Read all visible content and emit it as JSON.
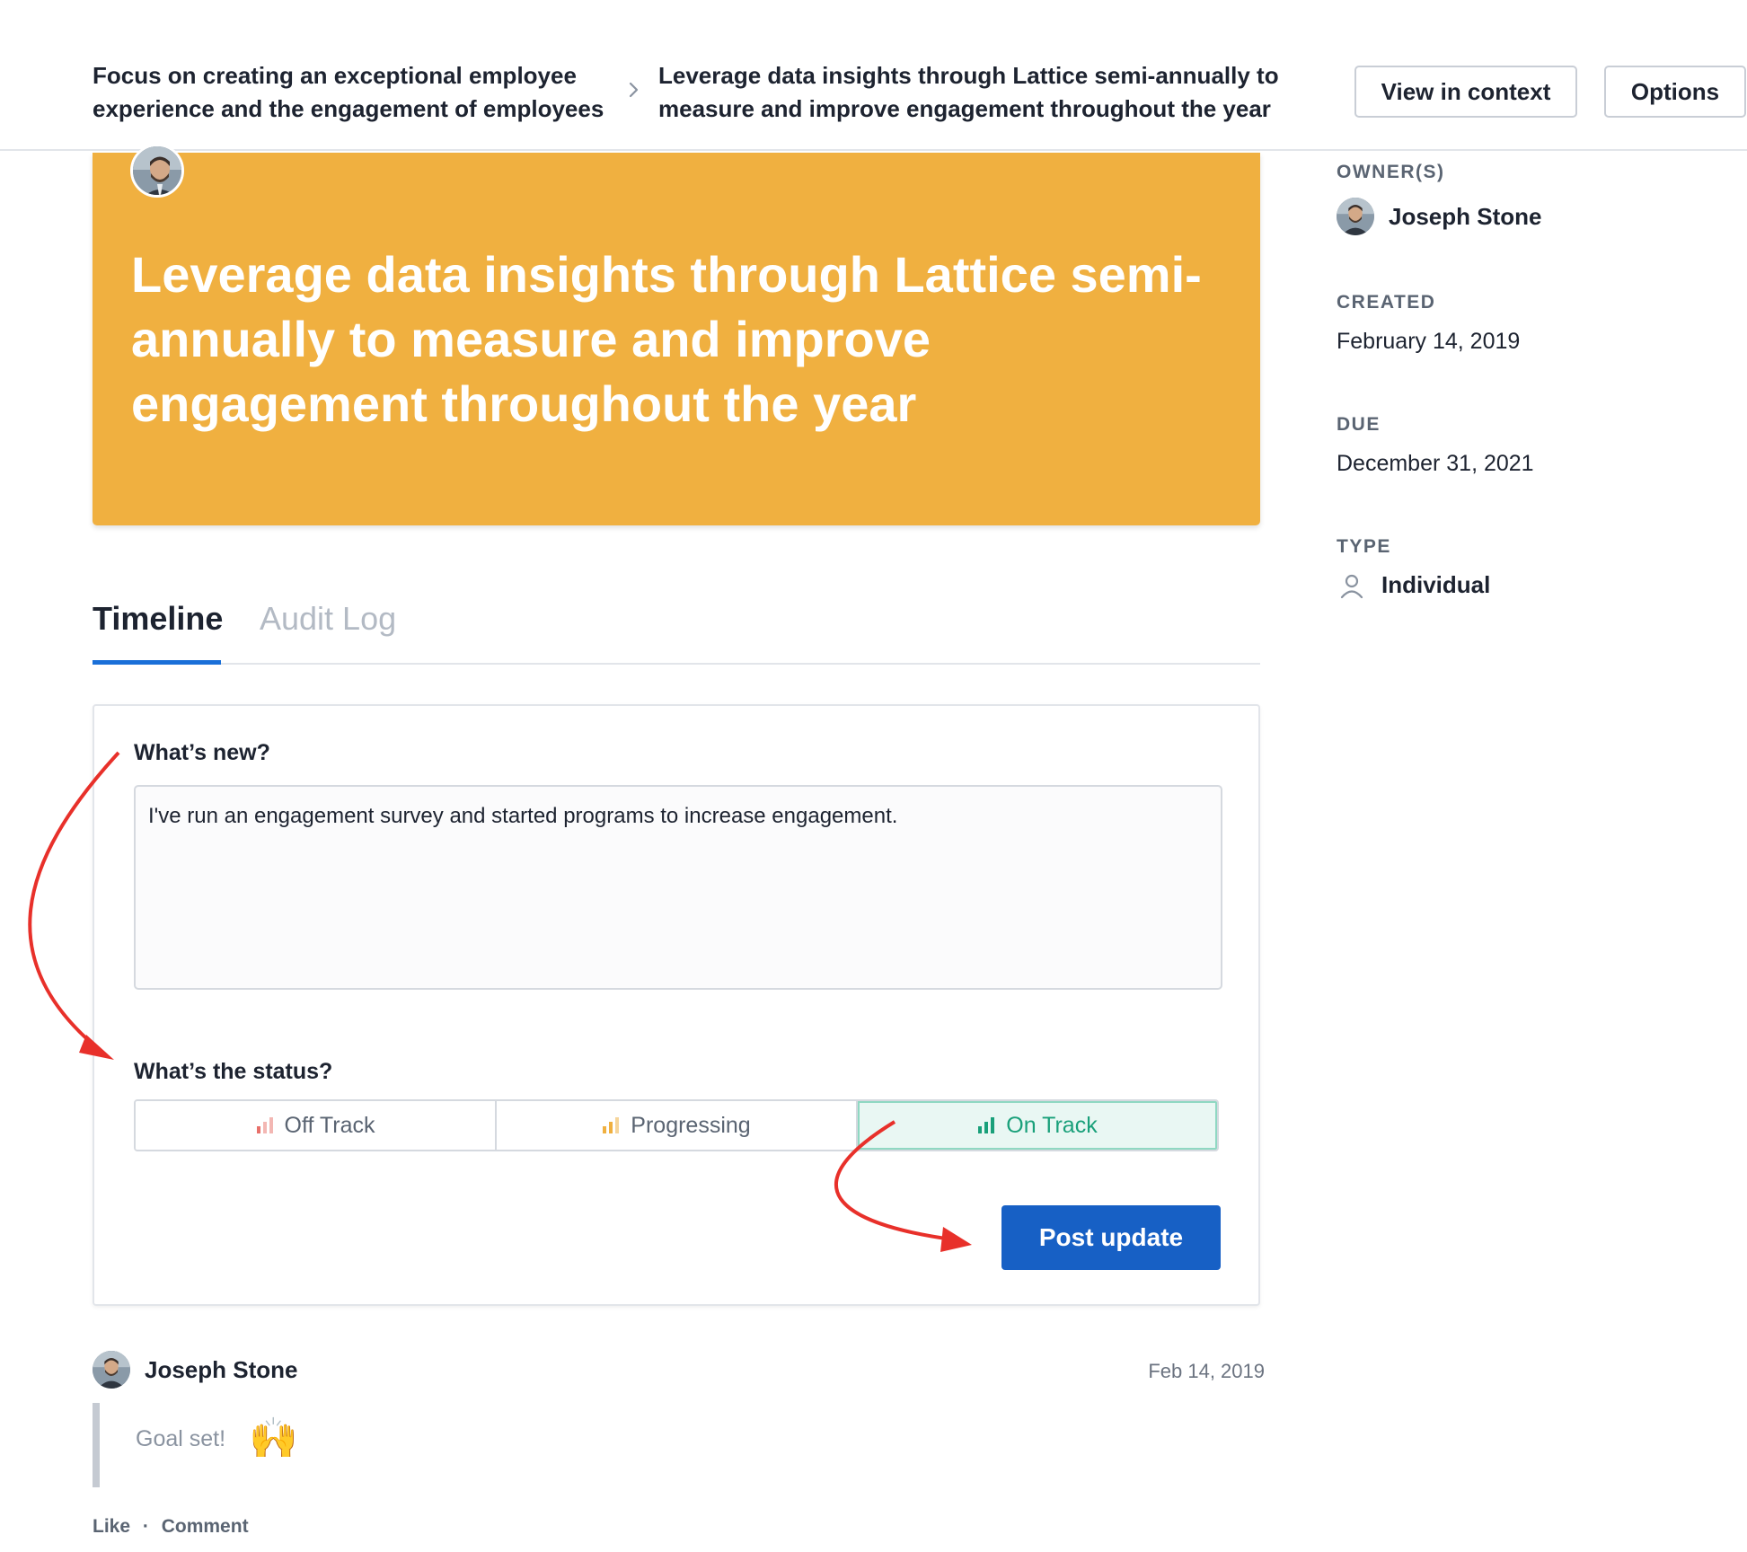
{
  "header": {
    "breadcrumb_parent": "Focus on creating an exceptional employee experience and the engagement of employees",
    "breadcrumb_current": "Leverage data insights through Lattice semi-annually to measure and improve engagement throughout the year",
    "view_in_context_label": "View in context",
    "options_label": "Options"
  },
  "banner": {
    "title": "Leverage data insights through Lattice semi-annually to measure and improve engagement throughout the year",
    "color": "#f0b040"
  },
  "sidebar": {
    "owners_label": "OWNER(S)",
    "owner_name": "Joseph Stone",
    "created_label": "CREATED",
    "created_value": "February 14, 2019",
    "due_label": "DUE",
    "due_value": "December 31, 2021",
    "type_label": "TYPE",
    "type_value": "Individual",
    "type_icon": "person-icon"
  },
  "tabs": [
    {
      "label": "Timeline",
      "active": true
    },
    {
      "label": "Audit Log",
      "active": false
    }
  ],
  "update_form": {
    "whats_new_label": "What’s new?",
    "whats_new_value": "I've run an engagement survey and started programs to increase engagement.",
    "status_label": "What’s the status?",
    "status_options": [
      {
        "label": "Off Track",
        "color": "#e8706a",
        "selected": false
      },
      {
        "label": "Progressing",
        "color": "#f0b040",
        "selected": false
      },
      {
        "label": "On Track",
        "color": "#19a07a",
        "selected": true
      }
    ],
    "post_button_label": "Post update",
    "post_button_color": "#1760c5"
  },
  "feed": {
    "author": "Joseph Stone",
    "date": "Feb 14, 2019",
    "text": "Goal set!",
    "emoji": "🙌",
    "like_label": "Like",
    "separator": "·",
    "comment_label": "Comment"
  },
  "accent_color": "#1a6fd8",
  "annotation_arrow_color": "#e8302a"
}
